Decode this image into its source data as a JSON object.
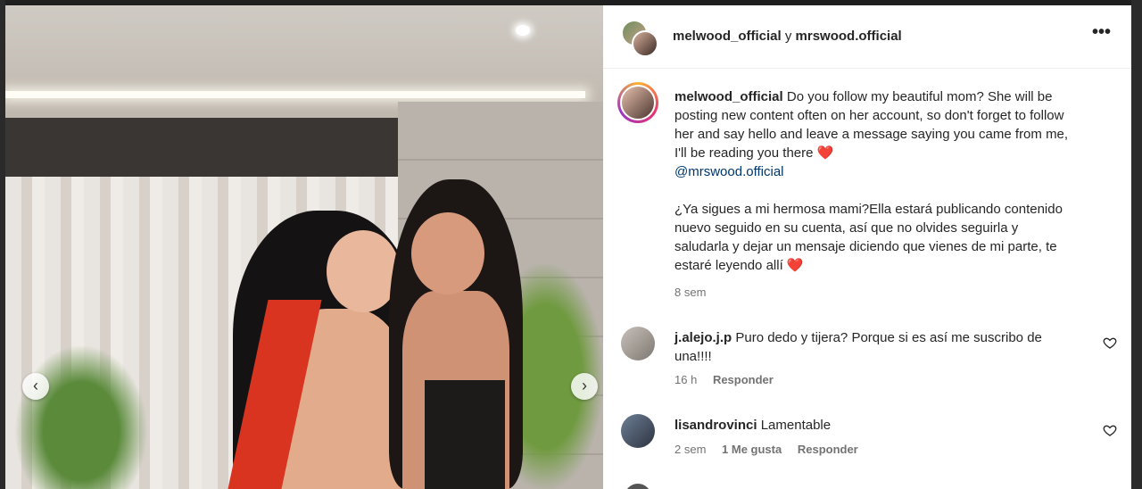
{
  "post": {
    "header": {
      "author_primary": "melwood_official",
      "connector": "y",
      "author_secondary": "mrswood.official",
      "more_icon": "more-horizontal-icon",
      "more_label": "•••"
    },
    "caption": {
      "username": "melwood_official",
      "text_en": "Do you follow my beautiful mom? She will be posting new content often on her account, so don't forget to follow her and say hello and leave a message saying you came from me, I'll be reading you there",
      "mention": "@mrswood.official",
      "text_es": "¿Ya sigues a mi hermosa mami?Ella estará publicando contenido nuevo seguido en su cuenta, así que no olvides seguirla y saludarla y dejar un mensaje diciendo que vienes de mi parte, te estaré leyendo allí",
      "heart": "❤️",
      "time": "8 sem"
    },
    "comments": [
      {
        "username": "j.alejo.j.p",
        "text": "Puro dedo y tijera? Porque si es así me suscribo de una!!!!",
        "time": "16 h",
        "reply_label": "Responder"
      },
      {
        "username": "lisandrovinci",
        "text": "Lamentable",
        "time": "2 sem",
        "likes": "1 Me gusta",
        "reply_label": "Responder"
      }
    ]
  },
  "carousel": {
    "prev_icon": "chevron-left-icon",
    "prev_glyph": "‹",
    "next_icon": "chevron-right-icon",
    "next_glyph": "›"
  },
  "colors": {
    "mention": "#00376b",
    "heart": "#e0245e",
    "muted": "#737373"
  }
}
